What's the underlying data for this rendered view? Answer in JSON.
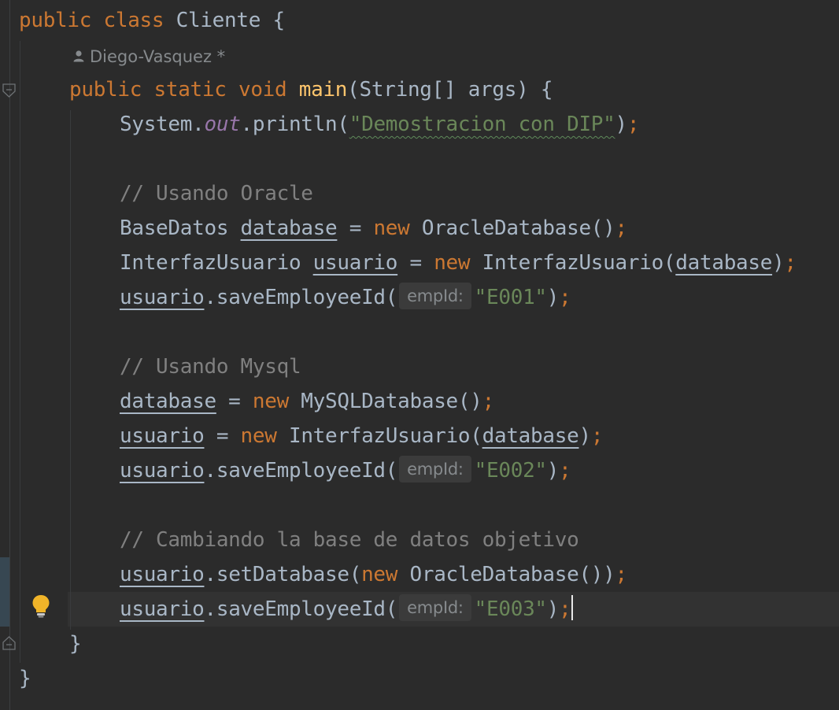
{
  "editor": {
    "author_hint": "Diego-Vasquez *",
    "param_hint": "empId:",
    "lines": {
      "l1": {
        "kw1": "public",
        "kw2": "class",
        "name": "Cliente",
        "brace": " {"
      },
      "l3": {
        "kw1": "public",
        "kw2": "static",
        "kw3": "void",
        "fn": "main",
        "rest": "(String[] args) {"
      },
      "l4": {
        "a": "System.",
        "field": "out",
        "b": ".println(",
        "str": "\"Demostracion con DIP\"",
        "c": ")",
        "semi": ";"
      },
      "l6": {
        "comment": "// Usando Oracle"
      },
      "l7": {
        "type": "BaseDatos ",
        "var": "database",
        "eq": " = ",
        "kw": "new",
        "rest": " OracleDatabase()",
        "semi": ";"
      },
      "l8": {
        "type": "InterfazUsuario ",
        "var": "usuario",
        "eq": " = ",
        "kw": "new",
        "rest": " InterfazUsuario(",
        "arg": "database",
        "close": ")",
        "semi": ";"
      },
      "l9": {
        "var": "usuario",
        "call": ".saveEmployeeId(",
        "str": "\"E001\"",
        "close": ")",
        "semi": ";"
      },
      "l11": {
        "comment": "// Usando Mysql"
      },
      "l12": {
        "var": "database",
        "eq": " = ",
        "kw": "new",
        "rest": " MySQLDatabase()",
        "semi": ";"
      },
      "l13": {
        "var": "usuario",
        "eq": " = ",
        "kw": "new",
        "rest": " InterfazUsuario(",
        "arg": "database",
        "close": ")",
        "semi": ";"
      },
      "l14": {
        "var": "usuario",
        "call": ".saveEmployeeId(",
        "str": "\"E002\"",
        "close": ")",
        "semi": ";"
      },
      "l16": {
        "comment": "// Cambiando la base de datos objetivo"
      },
      "l17": {
        "var": "usuario",
        "call": ".setDatabase(",
        "kw": "new",
        "rest": " OracleDatabase())",
        "semi": ";"
      },
      "l18": {
        "var": "usuario",
        "call": ".saveEmployeeId(",
        "str": "\"E003\"",
        "close": ")",
        "semi": ";"
      },
      "l19": {
        "brace": "}"
      },
      "l20": {
        "brace": "}"
      }
    }
  },
  "icons": {
    "user": "user-icon",
    "bulb": "lightbulb-icon",
    "fold": "fold-marker-icon"
  },
  "colors": {
    "keyword": "#cc7832",
    "string": "#6a8759",
    "comment": "#808080",
    "function": "#ffc66d",
    "static_field": "#9876aa",
    "background": "#2b2b2b"
  }
}
